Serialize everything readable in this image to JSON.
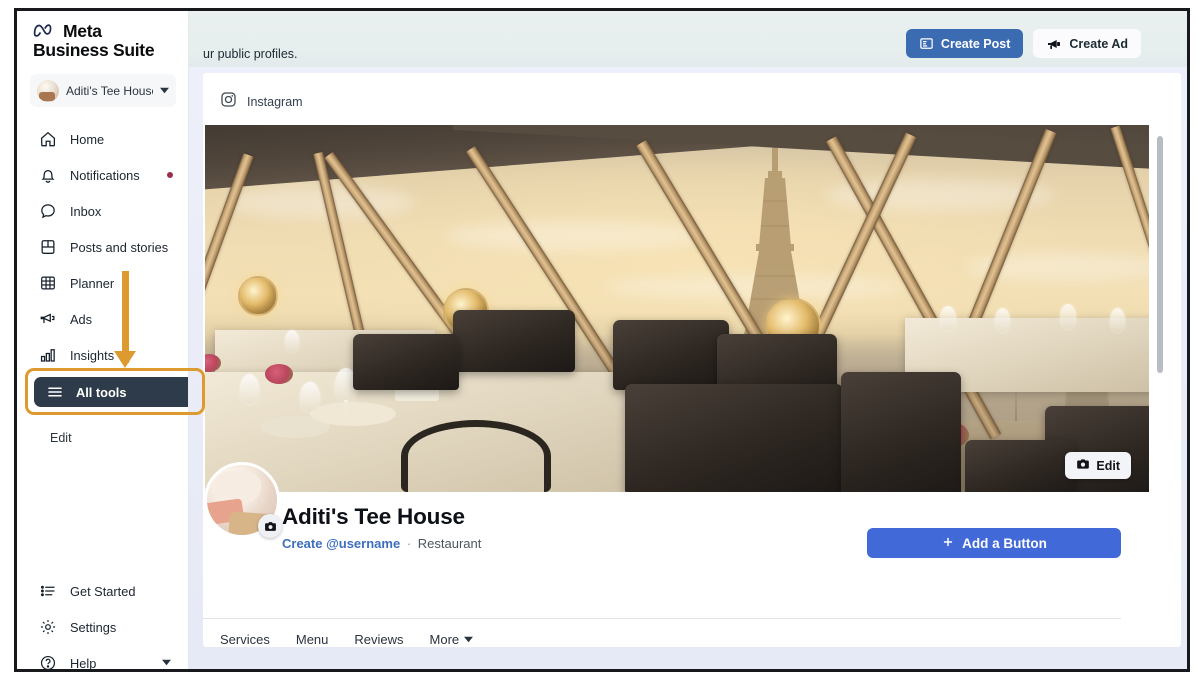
{
  "header": {
    "description_partial": "ur public profiles.",
    "create_post_label": "Create Post",
    "create_ad_label": "Create Ad",
    "primary_color": "#3b6bb0"
  },
  "sidebar": {
    "brand_line1": "Meta",
    "brand_line2": "Business Suite",
    "account": {
      "name": "Aditi's Tee House",
      "chevron": "chevron-down-icon"
    },
    "items": [
      {
        "label": "Home",
        "icon": "home-icon",
        "badge": false
      },
      {
        "label": "Notifications",
        "icon": "bell-icon",
        "badge": true
      },
      {
        "label": "Inbox",
        "icon": "chat-bubble-icon",
        "badge": false
      },
      {
        "label": "Posts and stories",
        "icon": "posts-icon",
        "badge": false
      },
      {
        "label": "Planner",
        "icon": "calendar-grid-icon",
        "badge": false
      },
      {
        "label": "Ads",
        "icon": "megaphone-icon",
        "badge": false
      },
      {
        "label": "Insights",
        "icon": "bar-chart-icon",
        "badge": false
      }
    ],
    "all_tools": {
      "label": "All tools",
      "icon": "hamburger-icon",
      "active": true,
      "bg": "#2d3b4a"
    },
    "edit_label": "Edit",
    "bottom_items": [
      {
        "label": "Get Started",
        "icon": "checklist-icon"
      },
      {
        "label": "Settings",
        "icon": "gear-icon"
      },
      {
        "label": "Help",
        "icon": "question-circle-icon",
        "chevron": true
      }
    ]
  },
  "content": {
    "platform_label": "Instagram",
    "platform_icon": "instagram-icon",
    "cover_edit_label": "Edit",
    "cover_edit_icon": "camera-icon",
    "profile_name": "Aditi's Tee House",
    "create_username_link": "Create @username",
    "separator": "·",
    "category": "Restaurant",
    "add_button_label": "Add a Button",
    "add_button_icon": "plus-icon",
    "add_button_color": "#4169d8",
    "avatar_camera_icon": "camera-icon",
    "tabs": [
      {
        "label": "Services",
        "chevron": false
      },
      {
        "label": "Menu",
        "chevron": false
      },
      {
        "label": "Reviews",
        "chevron": false
      },
      {
        "label": "More",
        "chevron": true
      }
    ]
  },
  "annotation": {
    "highlight_target": "All tools",
    "color": "#dd9a2e",
    "arrow": "down-arrow"
  }
}
